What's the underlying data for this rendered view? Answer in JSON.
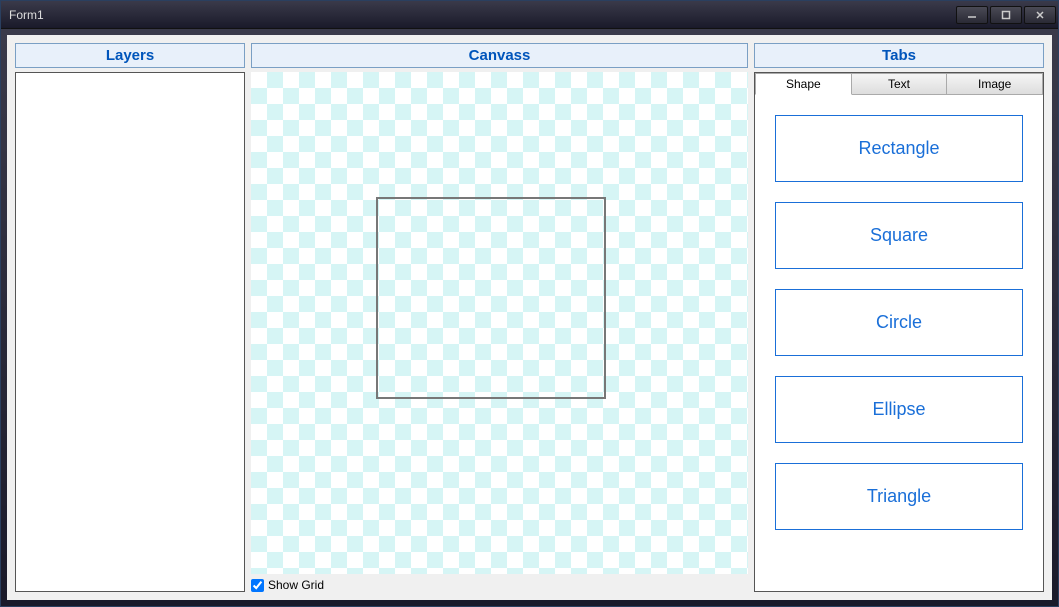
{
  "window": {
    "title": "Form1"
  },
  "panels": {
    "layers_title": "Layers",
    "canvas_title": "Canvass",
    "tabs_title": "Tabs"
  },
  "canvas": {
    "show_grid_label": "Show Grid",
    "show_grid_checked": true
  },
  "tabs": {
    "shape": "Shape",
    "text": "Text",
    "image": "Image"
  },
  "shapes": {
    "rectangle": "Rectangle",
    "square": "Square",
    "circle": "Circle",
    "ellipse": "Ellipse",
    "triangle": "Triangle"
  }
}
